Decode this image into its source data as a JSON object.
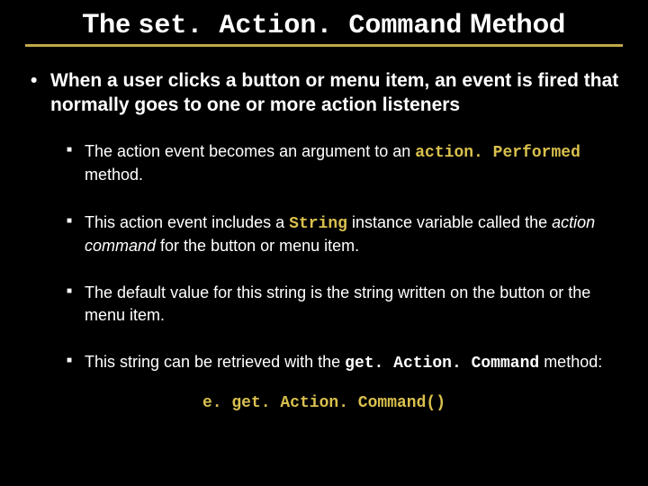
{
  "title": {
    "prefix": "The ",
    "code": "set. Action. Command",
    "suffix": " Method"
  },
  "main_bullet": "When a user clicks a button or menu item, an event is fired that normally goes to one or more action listeners",
  "sub": {
    "b1_prefix": "The action event becomes an argument to an ",
    "b1_code": "action. Performed",
    "b1_suffix": " method.",
    "b2_prefix": "This action event includes a ",
    "b2_code": "String",
    "b2_mid": " instance variable called the ",
    "b2_italic": "action command",
    "b2_suffix": " for the button or menu item.",
    "b3": "The default value for this string is the string written on the button or the menu item.",
    "b4_prefix": "This string can be retrieved with the ",
    "b4_code": "get. Action. Command",
    "b4_suffix": " method:"
  },
  "code_line": "e. get. Action. Command()"
}
